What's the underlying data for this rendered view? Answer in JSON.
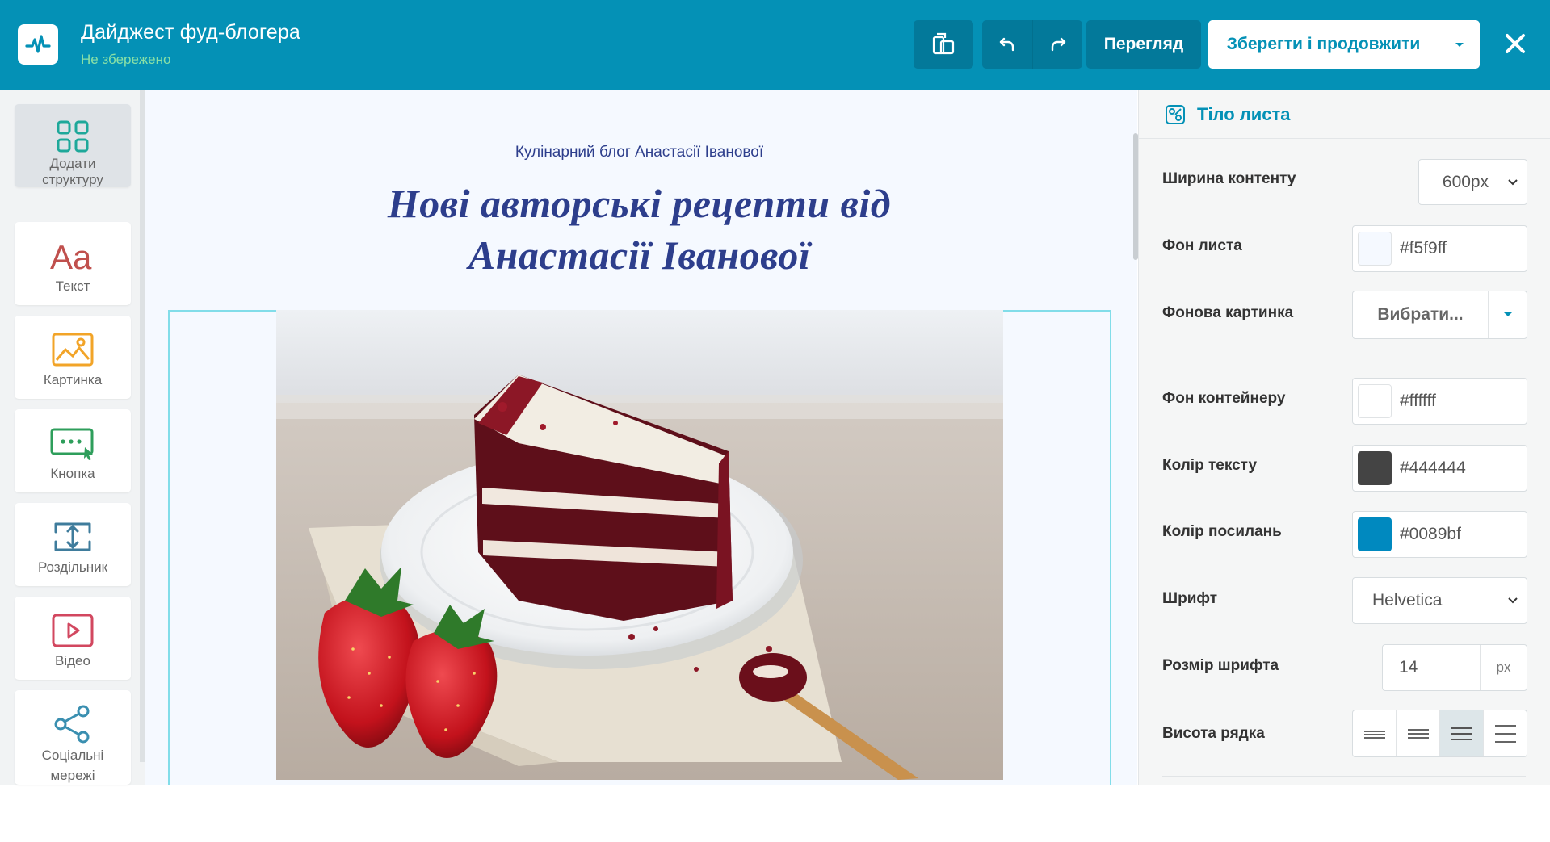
{
  "header": {
    "doc_title": "Дайджест фуд-блогера",
    "doc_status": "Не збережено",
    "preview_label": "Перегляд",
    "save_label": "Зберегти і продовжити",
    "close_glyph": "✕",
    "brand_color": "#0491b6",
    "status_color": "#89e0a6"
  },
  "sidebar": {
    "items": [
      {
        "label": "Додати\nструктуру",
        "icon": "grid-icon",
        "active": true
      },
      {
        "label": "Текст",
        "icon": "text-icon"
      },
      {
        "label": "Картинка",
        "icon": "image-icon"
      },
      {
        "label": "Кнопка",
        "icon": "button-icon"
      },
      {
        "label": "Роздільник",
        "icon": "divider-icon"
      },
      {
        "label": "Відео",
        "icon": "video-icon"
      },
      {
        "label": "Соціальні\nмережі",
        "icon": "share-icon"
      }
    ]
  },
  "canvas": {
    "subtitle": "Кулінарний блог Анастасії Іванової",
    "heading_line1": "Нові авторські рецепти від",
    "heading_line2": "Анастасії Іванової",
    "heading_color": "#2d3e8c",
    "background": "#f5f9ff",
    "selection_color": "#82dde9"
  },
  "panel": {
    "title": "Тіло листа",
    "props": {
      "content_width": {
        "label": "Ширина контенту",
        "value": "600px"
      },
      "page_bg": {
        "label": "Фон листа",
        "value": "#f5f9ff",
        "swatch": "#f5f9ff"
      },
      "bg_image": {
        "label": "Фонова картинка",
        "value": "Вибрати..."
      },
      "container_bg": {
        "label": "Фон контейнеру",
        "value": "#ffffff",
        "swatch": "#ffffff"
      },
      "text_color": {
        "label": "Колір тексту",
        "value": "#444444",
        "swatch": "#444444"
      },
      "link_color": {
        "label": "Колір посилань",
        "value": "#0089bf",
        "swatch": "#0089bf"
      },
      "font": {
        "label": "Шрифт",
        "value": "Helvetica"
      },
      "font_size": {
        "label": "Розмір шрифта",
        "value": "14",
        "unit": "px"
      },
      "line_height": {
        "label": "Висота рядка",
        "selected_index": 2
      }
    }
  }
}
